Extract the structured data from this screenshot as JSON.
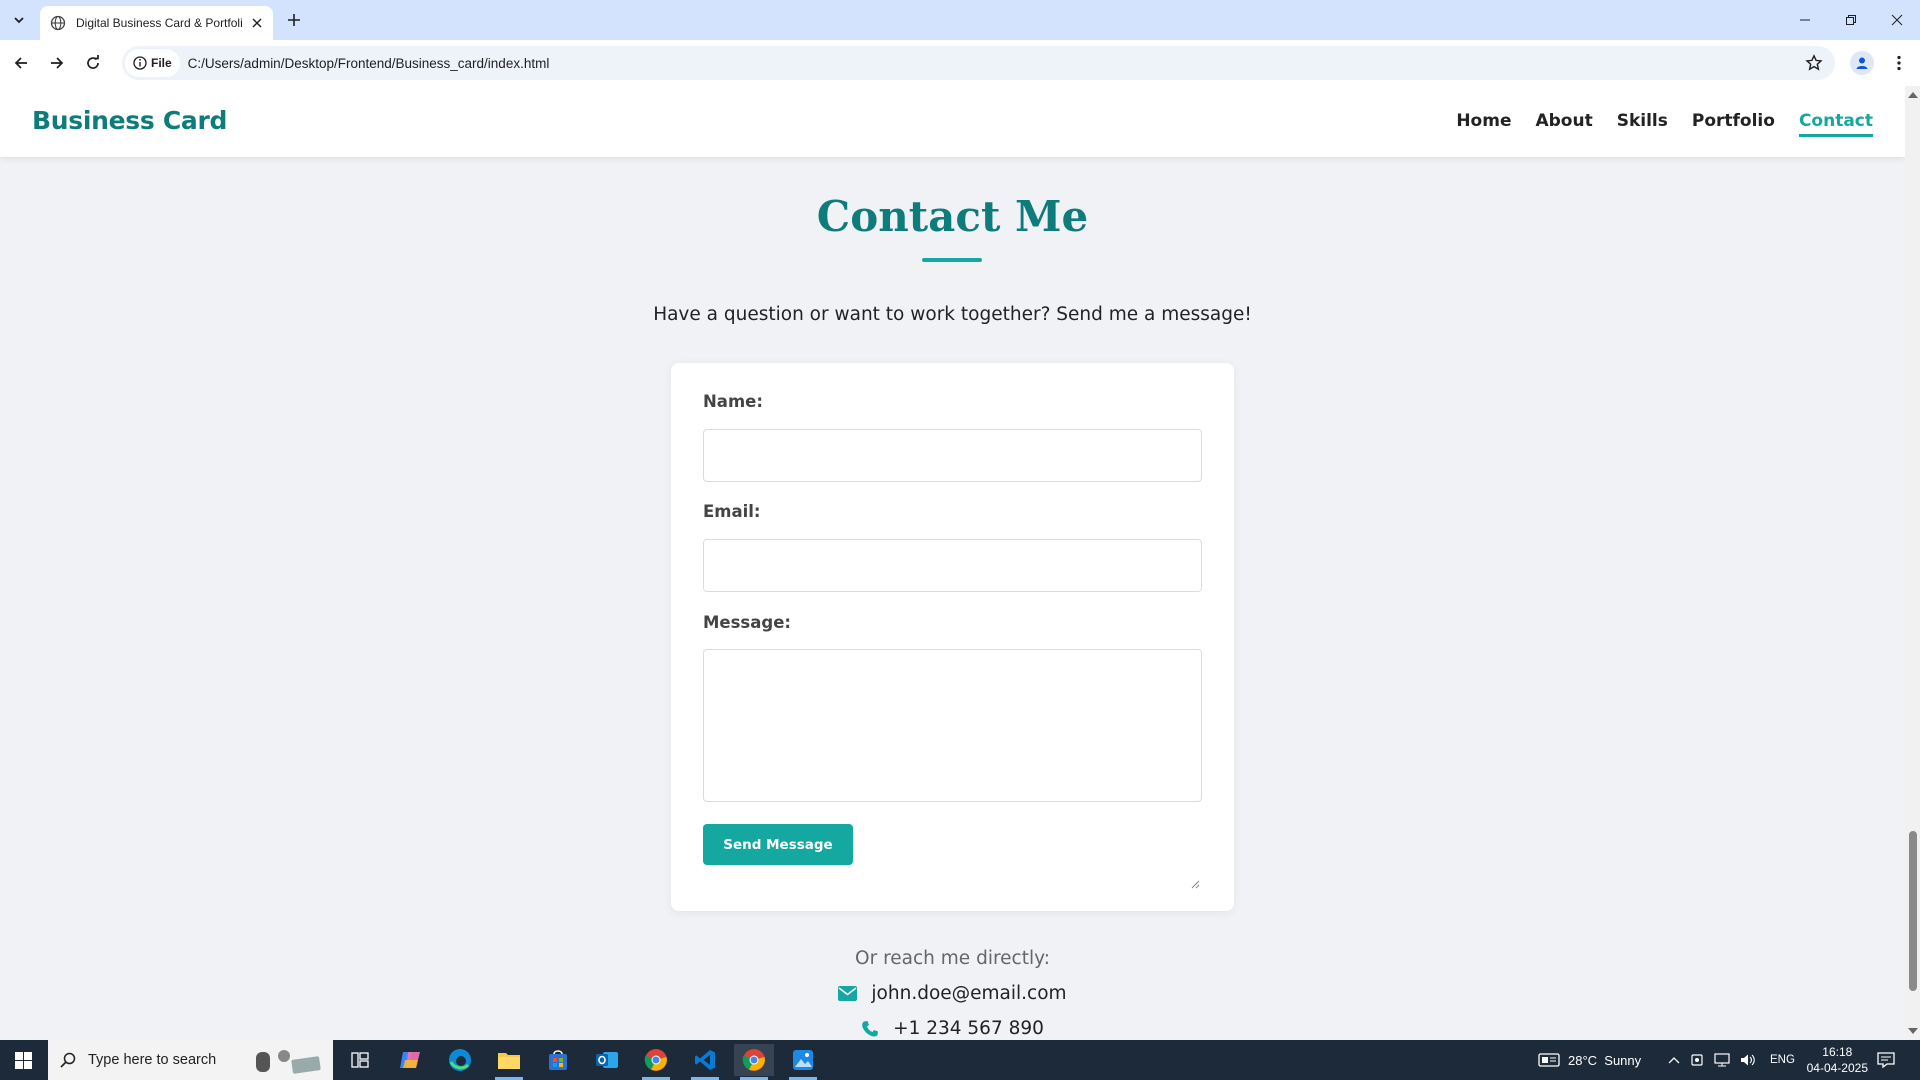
{
  "browser": {
    "tab_title": "Digital Business Card & Portfolio",
    "address_chip": "File",
    "url": "C:/Users/admin/Desktop/Frontend/Business_card/index.html"
  },
  "site": {
    "logo": "Business Card",
    "nav": [
      {
        "label": "Home",
        "active": false
      },
      {
        "label": "About",
        "active": false
      },
      {
        "label": "Skills",
        "active": false
      },
      {
        "label": "Portfolio",
        "active": false
      },
      {
        "label": "Contact",
        "active": true
      }
    ]
  },
  "contact": {
    "heading": "Contact Me",
    "intro": "Have a question or want to work together? Send me a message!",
    "name_label": "Name:",
    "name_value": "",
    "email_label": "Email:",
    "email_value": "",
    "message_label": "Message:",
    "message_value": "",
    "submit_label": "Send Message",
    "reach_text": "Or reach me directly:",
    "email": "john.doe@email.com",
    "phone": "+1 234 567 890"
  },
  "taskbar": {
    "search_placeholder": "Type here to search",
    "weather": "28°C  Sunny",
    "language": "ENG",
    "time": "16:18",
    "date": "04-04-2025"
  },
  "colors": {
    "accent": "#14a8a0",
    "heading": "#0e7c7b",
    "page_bg": "#f0f2f5",
    "tabbar_bg": "#d3e3fd",
    "taskbar_bg": "#1c2a3a"
  }
}
